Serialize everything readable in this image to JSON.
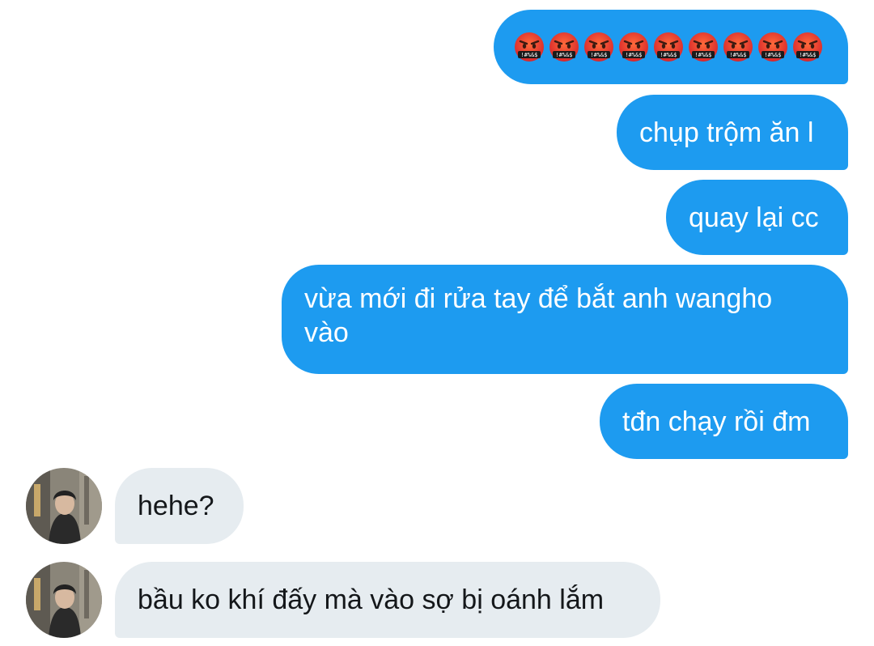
{
  "conversation": {
    "outgoing": [
      {
        "type": "emoji",
        "icon": "face-with-symbols-on-mouth-icon",
        "count": 9,
        "symbol_text": "!#%&$"
      },
      {
        "type": "text",
        "text": "chụp trộm ăn l"
      },
      {
        "type": "text",
        "text": "quay lại cc"
      },
      {
        "type": "text",
        "text": "vừa mới đi rửa tay để bắt anh wangho vào"
      },
      {
        "type": "text",
        "text": "tđn chạy rồi đm"
      }
    ],
    "incoming": [
      {
        "text": "hehe?",
        "avatar": "contact-avatar"
      },
      {
        "text": "bầu ko khí đấy mà vào sợ bị oánh lắm",
        "avatar": "contact-avatar"
      }
    ]
  },
  "colors": {
    "outgoing_bubble": "#1d9bf0",
    "incoming_bubble": "#e6ecf0",
    "outgoing_text": "#ffffff",
    "incoming_text": "#14171a"
  }
}
